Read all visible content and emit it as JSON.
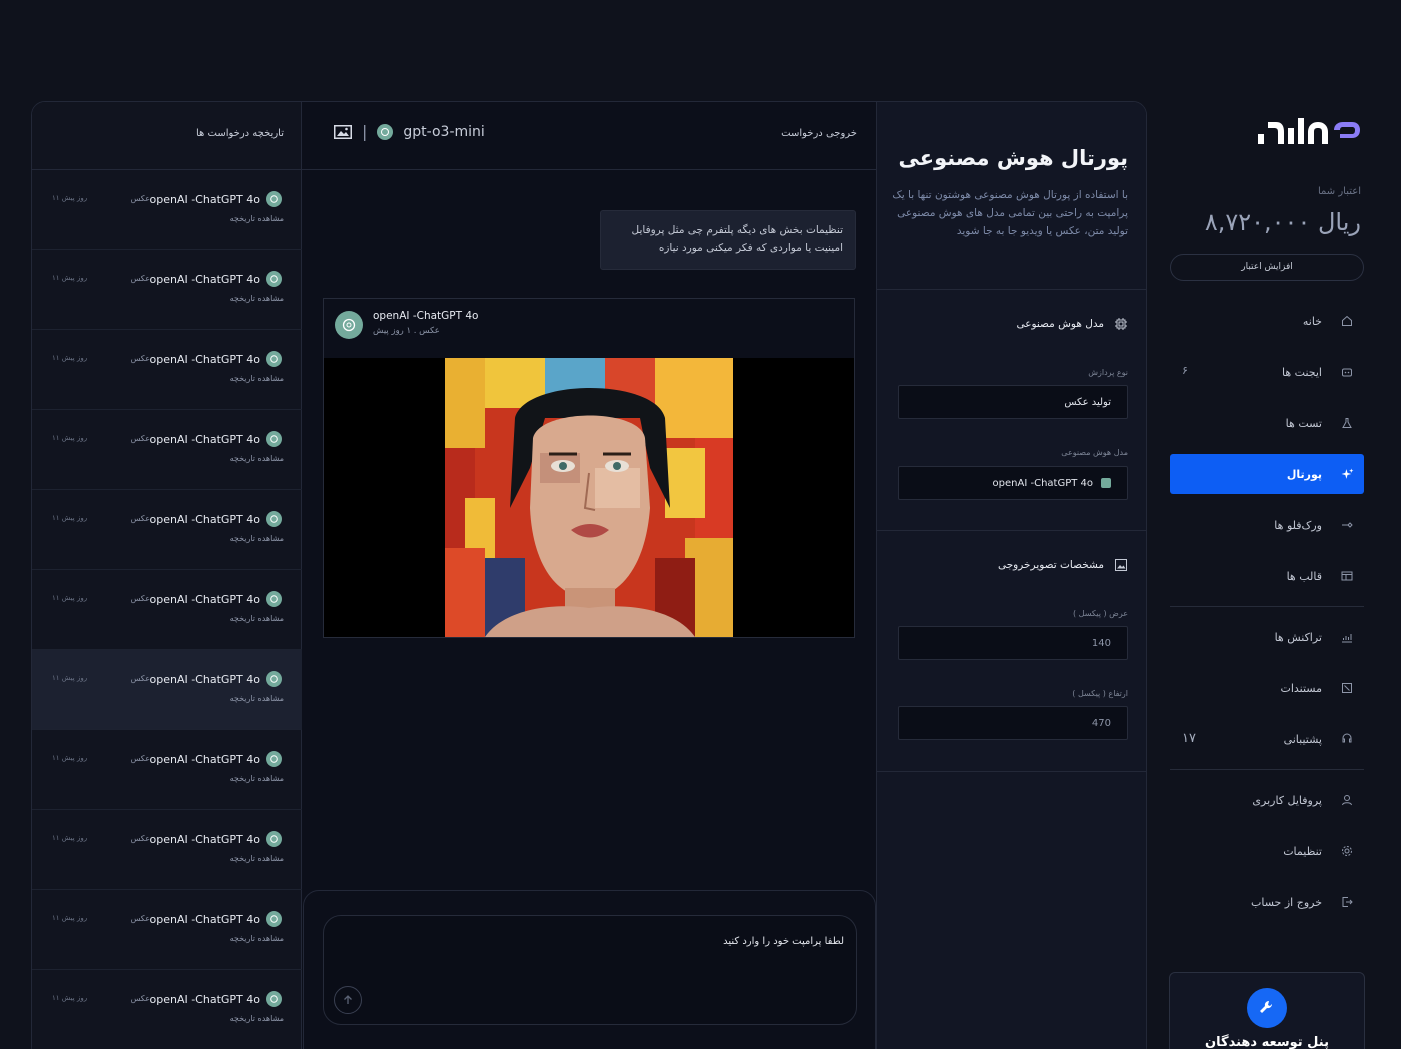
{
  "brand": {
    "logo_text": "هوشتون",
    "accent": "#0d5ef4"
  },
  "sidebar": {
    "credit_label": "اعتبار شما",
    "credit_amount": "۸,۷۲۰,۰۰۰ ریال",
    "credit_button": "افزایش اعتبار",
    "items": [
      {
        "label": "خانه",
        "icon": "home-icon",
        "badge": ""
      },
      {
        "label": "ایجنت ها",
        "icon": "robot-icon",
        "badge": "۶"
      },
      {
        "label": "تست ها",
        "icon": "flask-icon",
        "badge": ""
      },
      {
        "label": "پورتال",
        "icon": "sparkle-icon",
        "badge": "",
        "active": true
      },
      {
        "label": "ورک‌فلو ها",
        "icon": "workflow-icon",
        "badge": ""
      },
      {
        "label": "قالب ها",
        "icon": "template-icon",
        "badge": ""
      },
      {
        "label": "تراکنش ها",
        "icon": "chart-icon",
        "badge": ""
      },
      {
        "label": "مستندات",
        "icon": "document-icon",
        "badge": ""
      },
      {
        "label": "پشتیبانی",
        "icon": "support-icon",
        "badge": "۱۷"
      },
      {
        "label": "پروفایل کاربری",
        "icon": "user-icon",
        "badge": ""
      },
      {
        "label": "تنظیمات",
        "icon": "gear-icon",
        "badge": ""
      },
      {
        "label": "خروج از حساب",
        "icon": "logout-icon",
        "badge": ""
      }
    ],
    "dev_panel_label": "پنل توسعه دهندگان"
  },
  "history": {
    "title": "تاریخچه درخواست ها",
    "items": [
      {
        "model": "openAI -ChatGPT 4o",
        "type": "عکس",
        "time": "۱۱ روز پیش",
        "link": "مشاهده تاریخچه"
      },
      {
        "model": "openAI -ChatGPT 4o",
        "type": "عکس",
        "time": "۱۱ روز پیش",
        "link": "مشاهده تاریخچه"
      },
      {
        "model": "openAI -ChatGPT 4o",
        "type": "عکس",
        "time": "۱۱ روز پیش",
        "link": "مشاهده تاریخچه"
      },
      {
        "model": "openAI -ChatGPT 4o",
        "type": "عکس",
        "time": "۱۱ روز پیش",
        "link": "مشاهده تاریخچه"
      },
      {
        "model": "openAI -ChatGPT 4o",
        "type": "عکس",
        "time": "۱۱ روز پیش",
        "link": "مشاهده تاریخچه"
      },
      {
        "model": "openAI -ChatGPT 4o",
        "type": "عکس",
        "time": "۱۱ روز پیش",
        "link": "مشاهده تاریخچه"
      },
      {
        "model": "openAI -ChatGPT 4o",
        "type": "عکس",
        "time": "۱۱ روز پیش",
        "link": "مشاهده تاریخچه"
      },
      {
        "model": "openAI -ChatGPT 4o",
        "type": "عکس",
        "time": "۱۱ روز پیش",
        "link": "مشاهده تاریخچه"
      },
      {
        "model": "openAI -ChatGPT 4o",
        "type": "عکس",
        "time": "۱۱ روز پیش",
        "link": "مشاهده تاریخچه"
      },
      {
        "model": "openAI -ChatGPT 4o",
        "type": "عکس",
        "time": "۱۱ روز پیش",
        "link": "مشاهده تاریخچه"
      },
      {
        "model": "openAI -ChatGPT 4o",
        "type": "عکس",
        "time": "۱۱ روز پیش",
        "link": "مشاهده تاریخچه"
      }
    ]
  },
  "chat": {
    "output_label": "خروجی درخواست",
    "model_name": "gpt-o3-mini",
    "user_message": "تنظیمات بخش های دیگه پلتفرم چی مثل پروفایل امینیت یا مواردی که فکر میکنی مورد نیازه",
    "response": {
      "model": "openAI -ChatGPT 4o",
      "meta": "عکس . ۱ روز پیش"
    },
    "prompt_placeholder": "لطفا پرامپت خود را وارد کنید"
  },
  "settings": {
    "title": "پورتال هوش مصنوعی",
    "description": "با استفاده از پورتال هوش مصنوعی هوشتون تنها با یک پرامپت به راحتی بین تمامی مدل های هوش مصنوعی تولید متن، عکس یا ویدیو جا به جا شوید",
    "model_section": "مدل هوش مصنوعی",
    "processing_label": "نوع پردازش",
    "processing_value": "تولید عکس",
    "model_label": "مدل هوش مصنوعی",
    "model_value": "openAI -ChatGPT 4o",
    "output_section": "مشخصات تصویرخروجی",
    "width_label": "عرض ( پیکسل )",
    "width_value": "140",
    "height_label": "ارتفاع ( پیکسل )",
    "height_value": "470"
  }
}
